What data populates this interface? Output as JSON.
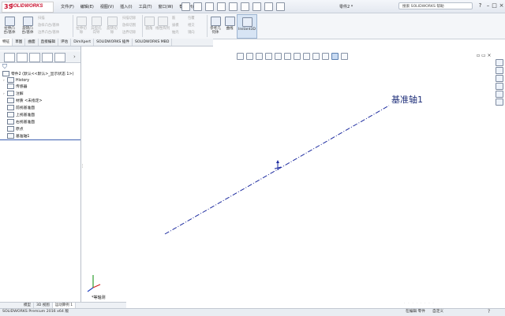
{
  "app": {
    "logo_ds": "3S",
    "logo_text": "SOLIDWORKS",
    "doc_title": "零件2 *",
    "search_placeholder": "搜索 SOLIDWORKS 帮助"
  },
  "menu": [
    "文件(F)",
    "编辑(E)",
    "视图(V)",
    "插入(I)",
    "工具(T)",
    "窗口(W)",
    "帮助(H)"
  ],
  "commands": {
    "extrude_boss": "拉伸凸台/基体",
    "revolve_boss": "旋转凸台/基体",
    "sweep": "扫描",
    "loft": "放样凸台/基体",
    "boundary_boss": "边界凸台/基体",
    "extrude_cut": "拉伸切除",
    "hole_wizard": "异型孔向导",
    "revolve_cut": "旋转切除",
    "sweep_cut": "扫描切除",
    "loft_cut": "放样切割",
    "boundary_cut": "边界切除",
    "fillet": "圆角",
    "linear_pattern": "线性阵列",
    "rib": "筋",
    "draft": "拔模",
    "shell": "抽壳",
    "wrap": "包覆",
    "intersect": "相交",
    "mirror": "镜向",
    "reference_geometry": "参考几何体",
    "curves": "曲线",
    "instant3d": "Instant3D"
  },
  "tabs": [
    "特征",
    "草图",
    "曲面",
    "直接编辑",
    "评估",
    "DimXpert",
    "SOLIDWORKS 插件",
    "SOLIDWORKS MBD"
  ],
  "tree": {
    "root": "零件2 (默认<<默认>_显示状态 1>)",
    "items": [
      "History",
      "传感器",
      "注解",
      "材质 <未指定>",
      "前视基准面",
      "上视基准面",
      "右视基准面",
      "原点",
      "基准轴1"
    ]
  },
  "graphics": {
    "axis_label": "基准轴1",
    "view_name": "*等轴测"
  },
  "bottom_tabs": [
    "模型",
    "3D 视图",
    "运动算例 1"
  ],
  "status": {
    "left": "SOLIDWORKS Premium 2016 x64 版",
    "mode": "在编辑 零件",
    "unit": "自定义"
  },
  "colors": {
    "axis_line": "#1e2ca0",
    "brand": "#c8102e"
  }
}
